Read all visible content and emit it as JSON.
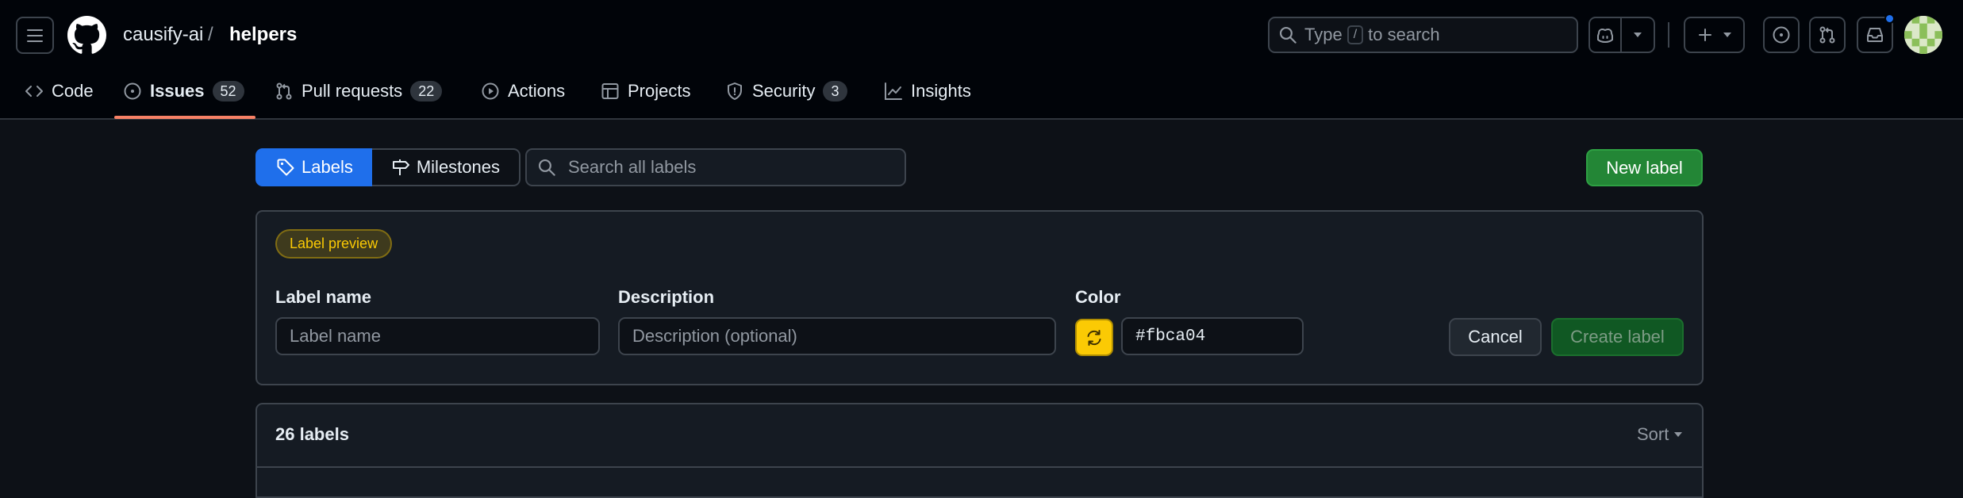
{
  "header": {
    "owner": "causify-ai",
    "separator": "/",
    "repo": "helpers",
    "search": {
      "prefix": "Type",
      "key": "/",
      "suffix": "to search"
    }
  },
  "tabs": [
    {
      "label": "Code",
      "icon": "code-icon"
    },
    {
      "label": "Issues",
      "icon": "issue-opened-icon",
      "count": "52",
      "active": true
    },
    {
      "label": "Pull requests",
      "icon": "git-pull-request-icon",
      "count": "22"
    },
    {
      "label": "Actions",
      "icon": "play-icon"
    },
    {
      "label": "Projects",
      "icon": "table-icon"
    },
    {
      "label": "Security",
      "icon": "shield-icon",
      "count": "3"
    },
    {
      "label": "Insights",
      "icon": "graph-icon"
    }
  ],
  "subnav": {
    "labels": "Labels",
    "milestones": "Milestones",
    "search_placeholder": "Search all labels",
    "new_label": "New label"
  },
  "form": {
    "preview": "Label preview",
    "name_label": "Label name",
    "name_placeholder": "Label name",
    "description_label": "Description",
    "description_placeholder": "Description (optional)",
    "color_label": "Color",
    "color_value": "#fbca04",
    "cancel": "Cancel",
    "create": "Create label"
  },
  "list": {
    "count": "26 labels",
    "sort": "Sort"
  },
  "colors": {
    "accent_blue": "#1f6feb",
    "primary_green": "#238636",
    "tab_underline": "#f78166",
    "label_color": "#fbca04"
  }
}
